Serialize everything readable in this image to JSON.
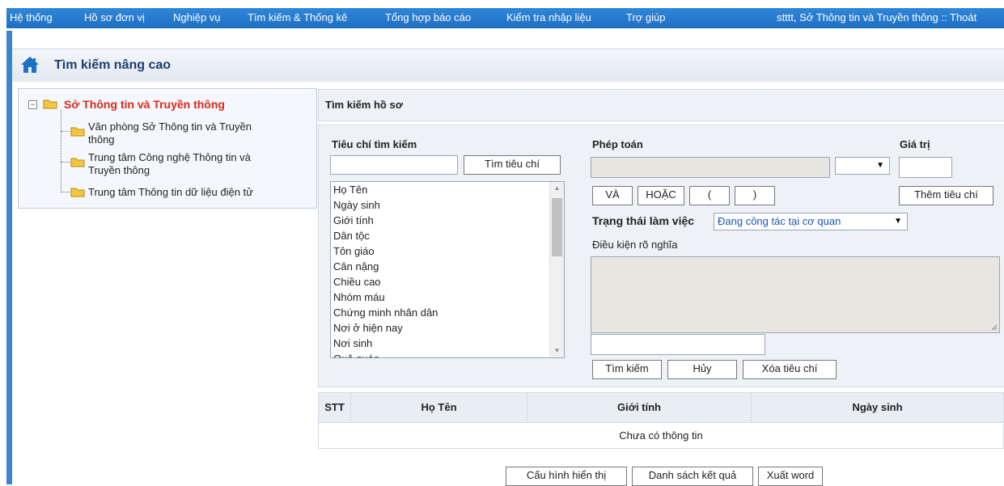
{
  "menu": {
    "items": [
      {
        "label": "Hệ thống"
      },
      {
        "label": "Hồ sơ đơn vị"
      },
      {
        "label": "Nghiệp vụ"
      },
      {
        "label": "Tìm kiếm & Thống kê"
      },
      {
        "label": "Tổng hợp báo cáo"
      },
      {
        "label": "Kiểm tra nhập liệu"
      },
      {
        "label": "Trợ giúp"
      }
    ],
    "user_info": "stttt, Sở Thông tin và Truyền thông :: Thoát"
  },
  "page": {
    "title": "Tìm kiếm nâng cao",
    "icon": "home-icon"
  },
  "tree": {
    "root": "Sở Thông tin và Truyền thông",
    "children": [
      {
        "line1": "Văn phòng Sở Thông tin và Truyền",
        "line2": "thông"
      },
      {
        "line1": "Trung tâm Công nghệ Thông tin và",
        "line2": "Truyền thông"
      },
      {
        "line1": "Trung tâm Thông tin dữ liệu điện tử",
        "line2": ""
      }
    ]
  },
  "search": {
    "header": "Tìm kiếm hồ sơ",
    "criteria_label": "Tiêu chí tìm kiếm",
    "criteria_input": "",
    "find_criteria_button": "Tìm tiêu chí",
    "criteria_list": [
      "Họ Tên",
      "Ngày sinh",
      "Giới tính",
      "Dân tộc",
      "Tôn giáo",
      "Cân nặng",
      "Chiều cao",
      "Nhóm máu",
      "Chứng minh nhân dân",
      "Nơi ở hiện nay",
      "Nơi sinh",
      "Quê quán"
    ],
    "operator_label": "Phép toán",
    "operator_value": "",
    "value_label": "Giá trị",
    "value_input": "",
    "and_button": "VÀ",
    "or_button": "HOẶC",
    "open_paren_button": "(",
    "close_paren_button": ")",
    "add_criteria_button": "Thêm tiêu chí",
    "status_label": "Trạng thái làm việc",
    "status_value": "Đang công tác tại cơ quan",
    "condition_label": "Điều kiện rõ nghĩa",
    "condition_text": "",
    "expression_input": "",
    "search_button": "Tìm kiếm",
    "cancel_button": "Hủy",
    "clear_button": "Xóa tiêu chí"
  },
  "results": {
    "columns": [
      "STT",
      "Họ Tên",
      "Giới tính",
      "Ngày sinh"
    ],
    "empty_message": "Chưa có thông tin",
    "config_button": "Cấu hình hiển thị",
    "result_list_button": "Danh sách kết quả",
    "export_word_button": "Xuất word"
  },
  "colors": {
    "menu_bar": "#1f6fc4",
    "tree_root": "#e0271d",
    "title": "#1d3d6e",
    "status_select_text": "#1a56b8"
  }
}
